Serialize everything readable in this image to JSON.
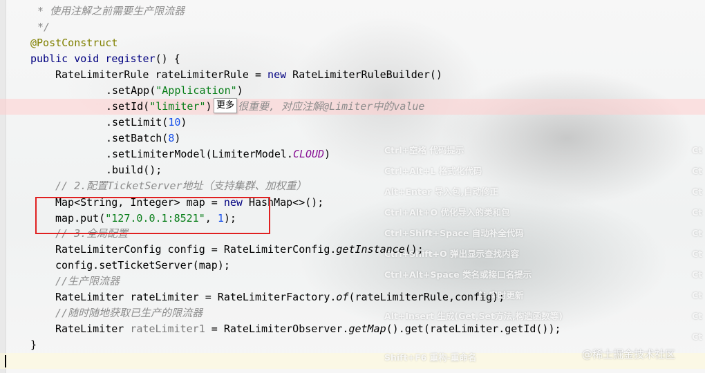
{
  "editor": {
    "lines": {
      "l1": "* 使用注解之前需要生产限流器",
      "l2": "*/",
      "annotation": "@PostConstruct",
      "sig_public": "public",
      "sig_void": "void",
      "sig_name": "register",
      "sig_rest": "() {",
      "l5_type": "RateLimiterRule rateLimiterRule = ",
      "l5_new": "new",
      "l5_rest": " RateLimiterRuleBuilder()",
      "l6_pre": ".setApp(",
      "l6_str": "\"Application\"",
      "l6_post": ")",
      "l7_pre": ".setId(",
      "l7_str": "\"limiter\"",
      "l7_post": ")",
      "l7_comment": "很重要, 对应注解@Limiter中的value",
      "l8_pre": ".setLimit(",
      "l8_num": "10",
      "l8_post": ")",
      "l9_pre": ".setBatch(",
      "l9_num": "8",
      "l9_post": ")",
      "l10_pre": ".setLimiterModel(LimiterModel.",
      "l10_const": "CLOUD",
      "l10_post": ")",
      "l11": ".build();",
      "l12": "// 2.配置TicketServer地址（支持集群、加权重）",
      "l13_pre": "Map<String, Integer> map = ",
      "l13_new": "new",
      "l13_post": " HashMap<>();",
      "l14_pre": "map.put(",
      "l14_str": "\"127.0.0.1:8521\"",
      "l14_mid": ", ",
      "l14_num": "1",
      "l14_post": ");",
      "l15": "// 3.全局配置",
      "l16_pre": "RateLimiterConfig config = RateLimiterConfig.",
      "l16_static": "getInstance",
      "l16_post": "();",
      "l17": "config.setTicketServer(map);",
      "l18": "//生产限流器",
      "l19_pre": "RateLimiter rateLimiter = RateLimiterFactory.",
      "l19_static": "of",
      "l19_post": "(rateLimiterRule,config);",
      "l20": "//随时随地获取已生产的限流器",
      "l21_pre": "RateLimiter ",
      "l21_unused": "rateLimiter1",
      "l21_mid": " = RateLimiterObserver.",
      "l21_static": "getMap",
      "l21_post": "().get(rateLimiter.getId());",
      "l22": "}"
    },
    "tooltip": "更多"
  },
  "shortcuts": {
    "left": [
      "Ctrl+空格  代码提示",
      "Ctrl+Alt+L  格式化代码",
      "Alt+Enter  导入包,自动修正",
      "Ctrl+Alt+O  优化导入的类和包",
      "Ctrl+Shift+Space  自动补全代码",
      "Ctrl+Shift+O  弹出显示查找内容",
      "Ctrl+Alt+Space  类名或接口名提示",
      "...存,实时更新",
      "Alt+Insert  生成(Get,Set方法,构造函数等)",
      "Shift+F6  重构-重命名"
    ],
    "right": [
      "Ct",
      "Ct",
      "Ct",
      "Ct",
      "Ct",
      "Ct",
      "Ct",
      "Ct",
      "Ct",
      "Ct"
    ]
  },
  "watermark": "@稀土掘金技术社区"
}
